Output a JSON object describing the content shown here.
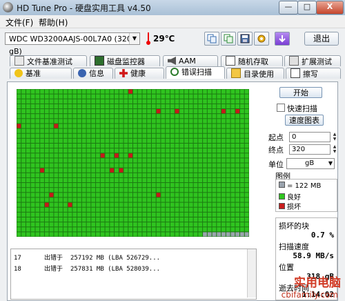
{
  "window": {
    "title": "HD Tune Pro - 硬盘实用工具 v4.50",
    "min": "—",
    "max": "□",
    "close": "X"
  },
  "menu": [
    "文件(F)",
    "帮助(H)"
  ],
  "drive": {
    "selected": "WDC WD3200AAJS-00L7A0 (320 gB)",
    "temperature": "29℃"
  },
  "toolbar": {
    "exit_label": "退出",
    "icons": [
      "copy-icon",
      "copy-all-icon",
      "save-icon",
      "options-icon",
      "download-icon"
    ]
  },
  "tabs_top": [
    "文件基准测试",
    "磁盘监控器",
    "AAM",
    "随机存取",
    "扩展测试"
  ],
  "tabs_bottom": [
    "基准",
    "信息",
    "健康",
    "错误扫描",
    "目录使用",
    "擦写"
  ],
  "active_tab": "错误扫描",
  "scan": {
    "start_label": "开始",
    "quick_scan_label": "快速扫描",
    "quick_scan_checked": false,
    "speed_map_label": "速度图表",
    "start_label_field": "起点",
    "start_value": "0",
    "end_label_field": "终点",
    "end_value": "320",
    "unit_label": "单位",
    "unit_value": "gB",
    "legend_title": "图例",
    "legend": [
      {
        "text": "= 122 MB",
        "color": "#9aa3ad"
      },
      {
        "text": "良好",
        "color": "#30c520"
      },
      {
        "text": "损坏",
        "color": "#c81e1e"
      }
    ],
    "damaged_blocks_label": "损坏的块",
    "damaged_blocks_value": "0.7 %",
    "scan_speed_label": "扫描速度",
    "scan_speed_value": "58.9 MB/s",
    "position_label": "位置",
    "position_value": "318 gB",
    "elapsed_label": "逝去时间",
    "elapsed_value": "1:14:02"
  },
  "grid": {
    "cols": 50,
    "rows": 30,
    "good_color": "#2fc41f",
    "bad_color": "#c61a1a",
    "pending_color": "#9aa3ad",
    "bad_cells": [
      [
        24,
        0
      ],
      [
        30,
        4
      ],
      [
        34,
        4
      ],
      [
        44,
        4
      ],
      [
        47,
        4
      ],
      [
        0,
        7
      ],
      [
        8,
        7
      ],
      [
        18,
        13
      ],
      [
        21,
        13
      ],
      [
        24,
        13
      ],
      [
        20,
        16
      ],
      [
        22,
        16
      ],
      [
        5,
        16
      ],
      [
        30,
        21
      ],
      [
        7,
        21
      ],
      [
        11,
        23
      ],
      [
        6,
        23
      ]
    ],
    "pending_from": [
      40,
      29
    ]
  },
  "log": [
    {
      "n": "17",
      "t": "出错于",
      "v": "257192 MB  (LBA 526729..."
    },
    {
      "n": "18",
      "t": "出错于",
      "v": "257831 MB  (LBA 528039..."
    }
  ],
  "watermark": {
    "site_cn": "实用电脑",
    "site_url": "cbifamily.com"
  }
}
